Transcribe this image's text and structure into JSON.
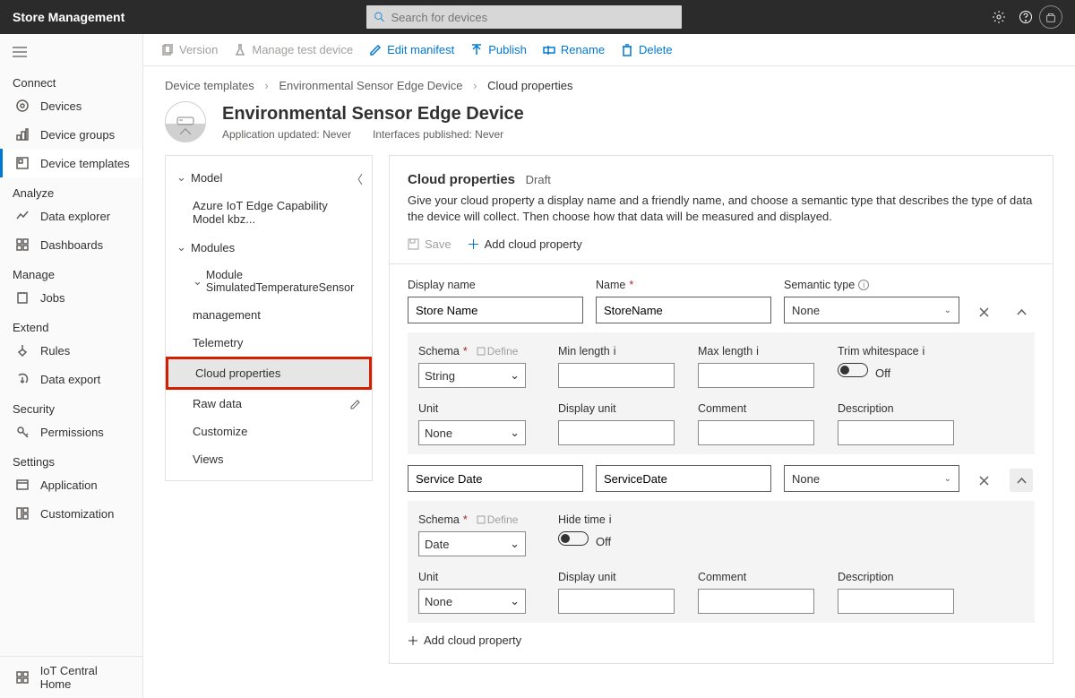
{
  "topbar": {
    "title": "Store Management",
    "search_placeholder": "Search for devices"
  },
  "sidebar": {
    "sections": [
      {
        "label": "Connect",
        "items": [
          {
            "label": "Devices"
          },
          {
            "label": "Device groups"
          },
          {
            "label": "Device templates",
            "active": true
          }
        ]
      },
      {
        "label": "Analyze",
        "items": [
          {
            "label": "Data explorer"
          },
          {
            "label": "Dashboards"
          }
        ]
      },
      {
        "label": "Manage",
        "items": [
          {
            "label": "Jobs"
          }
        ]
      },
      {
        "label": "Extend",
        "items": [
          {
            "label": "Rules"
          },
          {
            "label": "Data export"
          }
        ]
      },
      {
        "label": "Security",
        "items": [
          {
            "label": "Permissions"
          }
        ]
      },
      {
        "label": "Settings",
        "items": [
          {
            "label": "Application"
          },
          {
            "label": "Customization"
          }
        ]
      }
    ],
    "footer": {
      "label": "IoT Central Home"
    }
  },
  "actions": {
    "version": "Version",
    "manage_test": "Manage test device",
    "edit_manifest": "Edit manifest",
    "publish": "Publish",
    "rename": "Rename",
    "delete": "Delete"
  },
  "breadcrumb": {
    "a": "Device templates",
    "b": "Environmental Sensor Edge Device",
    "c": "Cloud properties"
  },
  "page": {
    "title": "Environmental Sensor Edge Device",
    "meta_updated": "Application updated: Never",
    "meta_published": "Interfaces published: Never"
  },
  "tree": {
    "model": "Model",
    "capability": "Azure IoT Edge Capability Model kbz...",
    "modules": "Modules",
    "module1": "Module SimulatedTemperatureSensor",
    "management": "management",
    "telemetry": "Telemetry",
    "cloud_properties": "Cloud properties",
    "raw_data": "Raw data",
    "customize": "Customize",
    "views": "Views"
  },
  "panel": {
    "title": "Cloud properties",
    "draft": "Draft",
    "description": "Give your cloud property a display name and a friendly name, and choose a semantic type that describes the type of data the device will collect. Then choose how that data will be measured and displayed.",
    "save": "Save",
    "add": "Add cloud property",
    "labels": {
      "display_name": "Display name",
      "name": "Name",
      "semantic_type": "Semantic type",
      "schema": "Schema",
      "define": "Define",
      "min_length": "Min length",
      "max_length": "Max length",
      "trim_ws": "Trim whitespace",
      "hide_time": "Hide time",
      "unit": "Unit",
      "display_unit": "Display unit",
      "comment": "Comment",
      "description_f": "Description",
      "off": "Off"
    },
    "props": [
      {
        "display_name": "Store Name",
        "name": "StoreName",
        "semantic_type": "None",
        "schema": "String",
        "unit": "None"
      },
      {
        "display_name": "Service Date",
        "name": "ServiceDate",
        "semantic_type": "None",
        "schema": "Date",
        "unit": "None"
      }
    ],
    "add_bottom": "Add cloud property"
  }
}
